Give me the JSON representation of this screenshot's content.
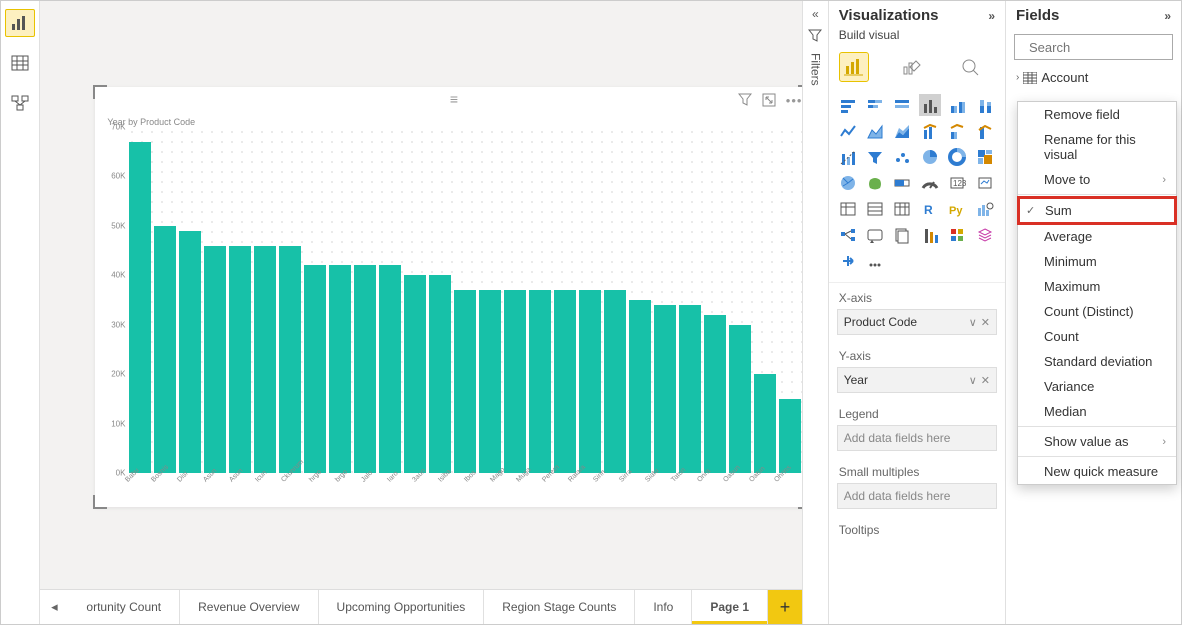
{
  "left_rail": {
    "items": [
      "chart-view",
      "table-view",
      "model-view"
    ]
  },
  "filters_label": "Filters",
  "visual": {
    "title": "Year by Product Code",
    "toolbar_icons": [
      "filter",
      "focus-mode",
      "more"
    ]
  },
  "chart_data": {
    "type": "bar",
    "title": "Year by Product Code",
    "xlabel": "",
    "ylabel": "",
    "ylim": [
      0,
      70
    ],
    "ytick_labels": [
      "0K",
      "10K",
      "20K",
      "30K",
      "40K",
      "50K",
      "60K",
      "70K"
    ],
    "categories": [
      "Babu",
      "Bosnis",
      "Disi",
      "Asun",
      "Asun",
      "Icun",
      "Ckunrum",
      "hrgo",
      "brgo",
      "Jalo",
      "Iaro",
      "3aun",
      "Isiba",
      "Ibos",
      "Mago",
      "Muga",
      "Perern",
      "Ratara",
      "Sirin",
      "Sirra",
      "Siatu",
      "Tatun",
      "Onra",
      "Oasun",
      "Oatun",
      "Ohrins"
    ],
    "values": [
      67,
      50,
      49,
      46,
      46,
      46,
      46,
      42,
      42,
      42,
      42,
      40,
      40,
      37,
      37,
      37,
      37,
      37,
      37,
      37,
      35,
      34,
      34,
      32,
      30,
      20,
      15
    ]
  },
  "page_tabs": {
    "items": [
      "ortunity Count",
      "Revenue Overview",
      "Upcoming Opportunities",
      "Region Stage Counts",
      "Info",
      "Page 1"
    ],
    "active_index": 5
  },
  "viz_panel": {
    "title": "Visualizations",
    "build_label": "Build visual",
    "wells": {
      "xaxis_label": "X-axis",
      "xaxis_value": "Product Code",
      "yaxis_label": "Y-axis",
      "yaxis_value": "Year",
      "legend_label": "Legend",
      "legend_placeholder": "Add data fields here",
      "sm_label": "Small multiples",
      "sm_placeholder": "Add data fields here",
      "tooltips_label": "Tooltips"
    }
  },
  "fields_panel": {
    "title": "Fields",
    "search_placeholder": "Search",
    "first_table": "Account"
  },
  "context_menu": {
    "remove": "Remove field",
    "rename": "Rename for this visual",
    "move": "Move to",
    "sum": "Sum",
    "avg": "Average",
    "min": "Minimum",
    "max": "Maximum",
    "count_d": "Count (Distinct)",
    "count": "Count",
    "std": "Standard deviation",
    "var": "Variance",
    "med": "Median",
    "show_as": "Show value as",
    "new_measure": "New quick measure"
  }
}
